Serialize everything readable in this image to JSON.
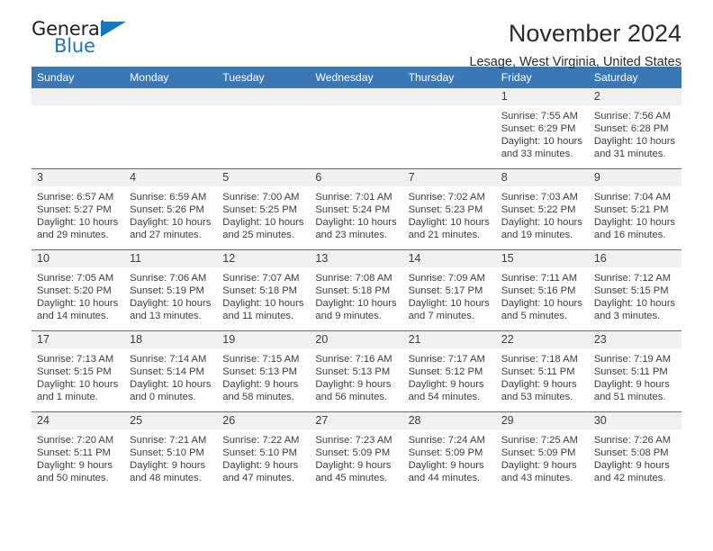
{
  "brand": {
    "name_top": "General",
    "name_bottom": "Blue",
    "accent_color": "#1b75bc"
  },
  "header": {
    "title": "November 2024",
    "location": "Lesage, West Virginia, United States",
    "header_bg_color": "#3b77b5",
    "daynum_bg_color": "#f0f0f0"
  },
  "weekday_headers": [
    "Sunday",
    "Monday",
    "Tuesday",
    "Wednesday",
    "Thursday",
    "Friday",
    "Saturday"
  ],
  "weeks": [
    [
      {
        "day": "",
        "sunrise": "",
        "sunset": "",
        "daylight_line1": "",
        "daylight_line2": ""
      },
      {
        "day": "",
        "sunrise": "",
        "sunset": "",
        "daylight_line1": "",
        "daylight_line2": ""
      },
      {
        "day": "",
        "sunrise": "",
        "sunset": "",
        "daylight_line1": "",
        "daylight_line2": ""
      },
      {
        "day": "",
        "sunrise": "",
        "sunset": "",
        "daylight_line1": "",
        "daylight_line2": ""
      },
      {
        "day": "",
        "sunrise": "",
        "sunset": "",
        "daylight_line1": "",
        "daylight_line2": ""
      },
      {
        "day": "1",
        "sunrise": "Sunrise: 7:55 AM",
        "sunset": "Sunset: 6:29 PM",
        "daylight_line1": "Daylight: 10 hours",
        "daylight_line2": "and 33 minutes."
      },
      {
        "day": "2",
        "sunrise": "Sunrise: 7:56 AM",
        "sunset": "Sunset: 6:28 PM",
        "daylight_line1": "Daylight: 10 hours",
        "daylight_line2": "and 31 minutes."
      }
    ],
    [
      {
        "day": "3",
        "sunrise": "Sunrise: 6:57 AM",
        "sunset": "Sunset: 5:27 PM",
        "daylight_line1": "Daylight: 10 hours",
        "daylight_line2": "and 29 minutes."
      },
      {
        "day": "4",
        "sunrise": "Sunrise: 6:59 AM",
        "sunset": "Sunset: 5:26 PM",
        "daylight_line1": "Daylight: 10 hours",
        "daylight_line2": "and 27 minutes."
      },
      {
        "day": "5",
        "sunrise": "Sunrise: 7:00 AM",
        "sunset": "Sunset: 5:25 PM",
        "daylight_line1": "Daylight: 10 hours",
        "daylight_line2": "and 25 minutes."
      },
      {
        "day": "6",
        "sunrise": "Sunrise: 7:01 AM",
        "sunset": "Sunset: 5:24 PM",
        "daylight_line1": "Daylight: 10 hours",
        "daylight_line2": "and 23 minutes."
      },
      {
        "day": "7",
        "sunrise": "Sunrise: 7:02 AM",
        "sunset": "Sunset: 5:23 PM",
        "daylight_line1": "Daylight: 10 hours",
        "daylight_line2": "and 21 minutes."
      },
      {
        "day": "8",
        "sunrise": "Sunrise: 7:03 AM",
        "sunset": "Sunset: 5:22 PM",
        "daylight_line1": "Daylight: 10 hours",
        "daylight_line2": "and 19 minutes."
      },
      {
        "day": "9",
        "sunrise": "Sunrise: 7:04 AM",
        "sunset": "Sunset: 5:21 PM",
        "daylight_line1": "Daylight: 10 hours",
        "daylight_line2": "and 16 minutes."
      }
    ],
    [
      {
        "day": "10",
        "sunrise": "Sunrise: 7:05 AM",
        "sunset": "Sunset: 5:20 PM",
        "daylight_line1": "Daylight: 10 hours",
        "daylight_line2": "and 14 minutes."
      },
      {
        "day": "11",
        "sunrise": "Sunrise: 7:06 AM",
        "sunset": "Sunset: 5:19 PM",
        "daylight_line1": "Daylight: 10 hours",
        "daylight_line2": "and 13 minutes."
      },
      {
        "day": "12",
        "sunrise": "Sunrise: 7:07 AM",
        "sunset": "Sunset: 5:18 PM",
        "daylight_line1": "Daylight: 10 hours",
        "daylight_line2": "and 11 minutes."
      },
      {
        "day": "13",
        "sunrise": "Sunrise: 7:08 AM",
        "sunset": "Sunset: 5:18 PM",
        "daylight_line1": "Daylight: 10 hours",
        "daylight_line2": "and 9 minutes."
      },
      {
        "day": "14",
        "sunrise": "Sunrise: 7:09 AM",
        "sunset": "Sunset: 5:17 PM",
        "daylight_line1": "Daylight: 10 hours",
        "daylight_line2": "and 7 minutes."
      },
      {
        "day": "15",
        "sunrise": "Sunrise: 7:11 AM",
        "sunset": "Sunset: 5:16 PM",
        "daylight_line1": "Daylight: 10 hours",
        "daylight_line2": "and 5 minutes."
      },
      {
        "day": "16",
        "sunrise": "Sunrise: 7:12 AM",
        "sunset": "Sunset: 5:15 PM",
        "daylight_line1": "Daylight: 10 hours",
        "daylight_line2": "and 3 minutes."
      }
    ],
    [
      {
        "day": "17",
        "sunrise": "Sunrise: 7:13 AM",
        "sunset": "Sunset: 5:15 PM",
        "daylight_line1": "Daylight: 10 hours",
        "daylight_line2": "and 1 minute."
      },
      {
        "day": "18",
        "sunrise": "Sunrise: 7:14 AM",
        "sunset": "Sunset: 5:14 PM",
        "daylight_line1": "Daylight: 10 hours",
        "daylight_line2": "and 0 minutes."
      },
      {
        "day": "19",
        "sunrise": "Sunrise: 7:15 AM",
        "sunset": "Sunset: 5:13 PM",
        "daylight_line1": "Daylight: 9 hours",
        "daylight_line2": "and 58 minutes."
      },
      {
        "day": "20",
        "sunrise": "Sunrise: 7:16 AM",
        "sunset": "Sunset: 5:13 PM",
        "daylight_line1": "Daylight: 9 hours",
        "daylight_line2": "and 56 minutes."
      },
      {
        "day": "21",
        "sunrise": "Sunrise: 7:17 AM",
        "sunset": "Sunset: 5:12 PM",
        "daylight_line1": "Daylight: 9 hours",
        "daylight_line2": "and 54 minutes."
      },
      {
        "day": "22",
        "sunrise": "Sunrise: 7:18 AM",
        "sunset": "Sunset: 5:11 PM",
        "daylight_line1": "Daylight: 9 hours",
        "daylight_line2": "and 53 minutes."
      },
      {
        "day": "23",
        "sunrise": "Sunrise: 7:19 AM",
        "sunset": "Sunset: 5:11 PM",
        "daylight_line1": "Daylight: 9 hours",
        "daylight_line2": "and 51 minutes."
      }
    ],
    [
      {
        "day": "24",
        "sunrise": "Sunrise: 7:20 AM",
        "sunset": "Sunset: 5:11 PM",
        "daylight_line1": "Daylight: 9 hours",
        "daylight_line2": "and 50 minutes."
      },
      {
        "day": "25",
        "sunrise": "Sunrise: 7:21 AM",
        "sunset": "Sunset: 5:10 PM",
        "daylight_line1": "Daylight: 9 hours",
        "daylight_line2": "and 48 minutes."
      },
      {
        "day": "26",
        "sunrise": "Sunrise: 7:22 AM",
        "sunset": "Sunset: 5:10 PM",
        "daylight_line1": "Daylight: 9 hours",
        "daylight_line2": "and 47 minutes."
      },
      {
        "day": "27",
        "sunrise": "Sunrise: 7:23 AM",
        "sunset": "Sunset: 5:09 PM",
        "daylight_line1": "Daylight: 9 hours",
        "daylight_line2": "and 45 minutes."
      },
      {
        "day": "28",
        "sunrise": "Sunrise: 7:24 AM",
        "sunset": "Sunset: 5:09 PM",
        "daylight_line1": "Daylight: 9 hours",
        "daylight_line2": "and 44 minutes."
      },
      {
        "day": "29",
        "sunrise": "Sunrise: 7:25 AM",
        "sunset": "Sunset: 5:09 PM",
        "daylight_line1": "Daylight: 9 hours",
        "daylight_line2": "and 43 minutes."
      },
      {
        "day": "30",
        "sunrise": "Sunrise: 7:26 AM",
        "sunset": "Sunset: 5:08 PM",
        "daylight_line1": "Daylight: 9 hours",
        "daylight_line2": "and 42 minutes."
      }
    ]
  ]
}
